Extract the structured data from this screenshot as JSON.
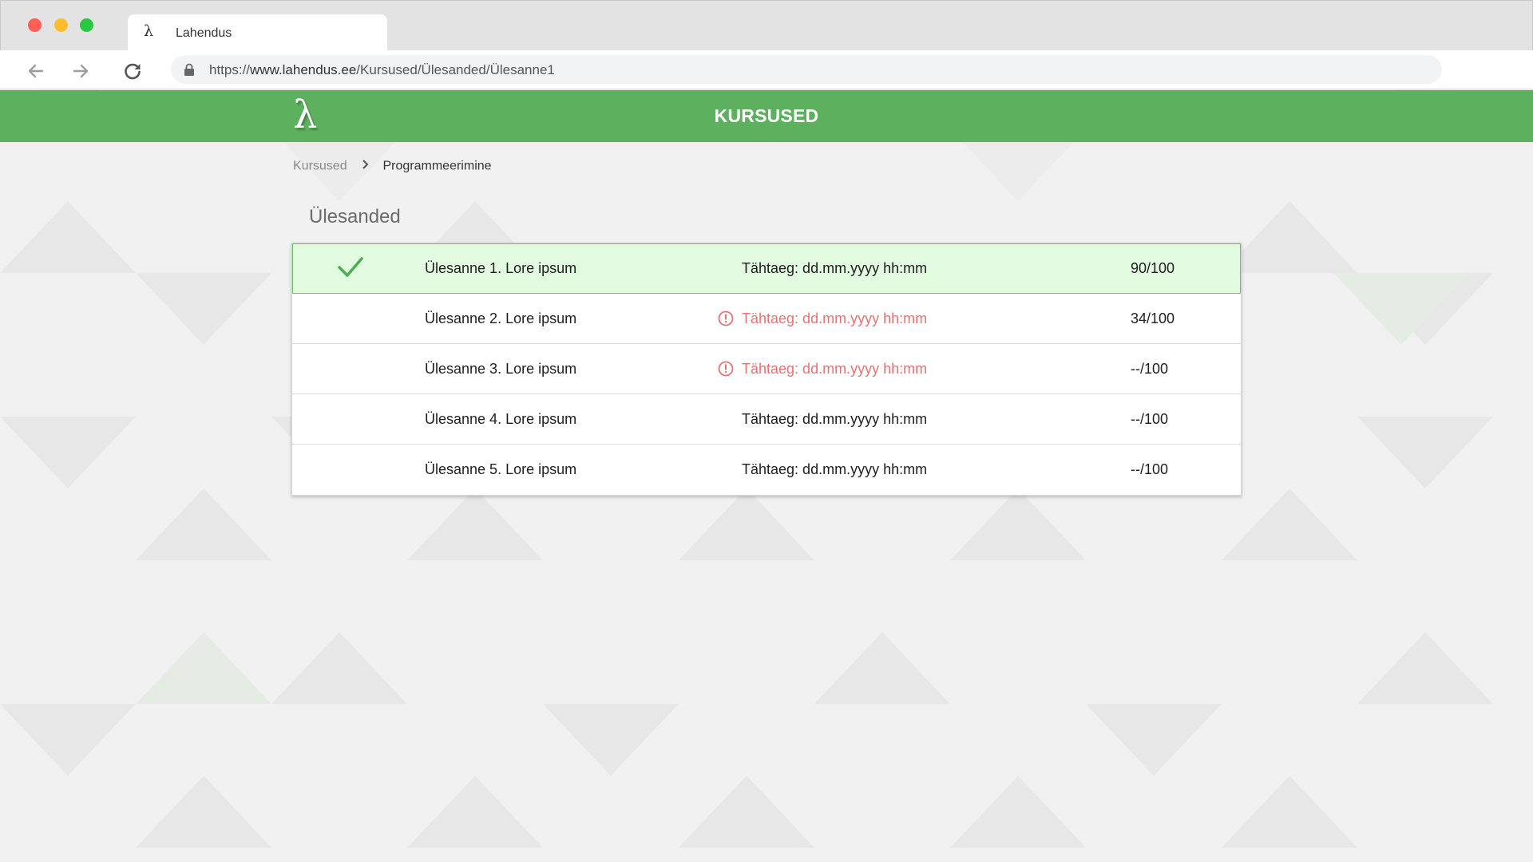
{
  "browser": {
    "tab": {
      "favicon": "λ",
      "title": "Lahendus"
    },
    "url": {
      "scheme": "https://",
      "host": "www.lahendus.ee",
      "path": "/Kursused/Ülesanded/Ülesanne1"
    },
    "icons": {
      "back": "arrow-left-icon",
      "forward": "arrow-right-icon",
      "reload": "reload-icon",
      "lock": "lock-icon"
    }
  },
  "header": {
    "logo": "λ",
    "title": "KURSUSED",
    "color": "#5db15e"
  },
  "breadcrumb": {
    "root": "Kursused",
    "separator_icon": "chevron-right-icon",
    "current": "Programmeerimine"
  },
  "section": {
    "title": "Ülesanded"
  },
  "tasks": [
    {
      "name": "Ülesanne 1. Lore ipsum",
      "deadline": "Tähtaeg: dd.mm.yyyy  hh:mm",
      "score": "90/100",
      "status": "completed",
      "status_icon": "checkmark-icon"
    },
    {
      "name": "Ülesanne 2. Lore ipsum",
      "deadline": "Tähtaeg: dd.mm.yyyy  hh:mm",
      "score": "34/100",
      "status": "overdue",
      "status_icon": "alert-circle-icon"
    },
    {
      "name": "Ülesanne 3. Lore ipsum",
      "deadline": "Tähtaeg: dd.mm.yyyy  hh:mm",
      "score": "--/100",
      "status": "overdue",
      "status_icon": "alert-circle-icon"
    },
    {
      "name": "Ülesanne 4. Lore ipsum",
      "deadline": "Tähtaeg: dd.mm.yyyy  hh:mm",
      "score": "--/100",
      "status": "open"
    },
    {
      "name": "Ülesanne 5. Lore ipsum",
      "deadline": "Tähtaeg: dd.mm.yyyy  hh:mm",
      "score": "--/100",
      "status": "open"
    }
  ],
  "colors": {
    "success": "#4caf50",
    "completed_row": "#e2fae0",
    "overdue": "#e57373"
  }
}
